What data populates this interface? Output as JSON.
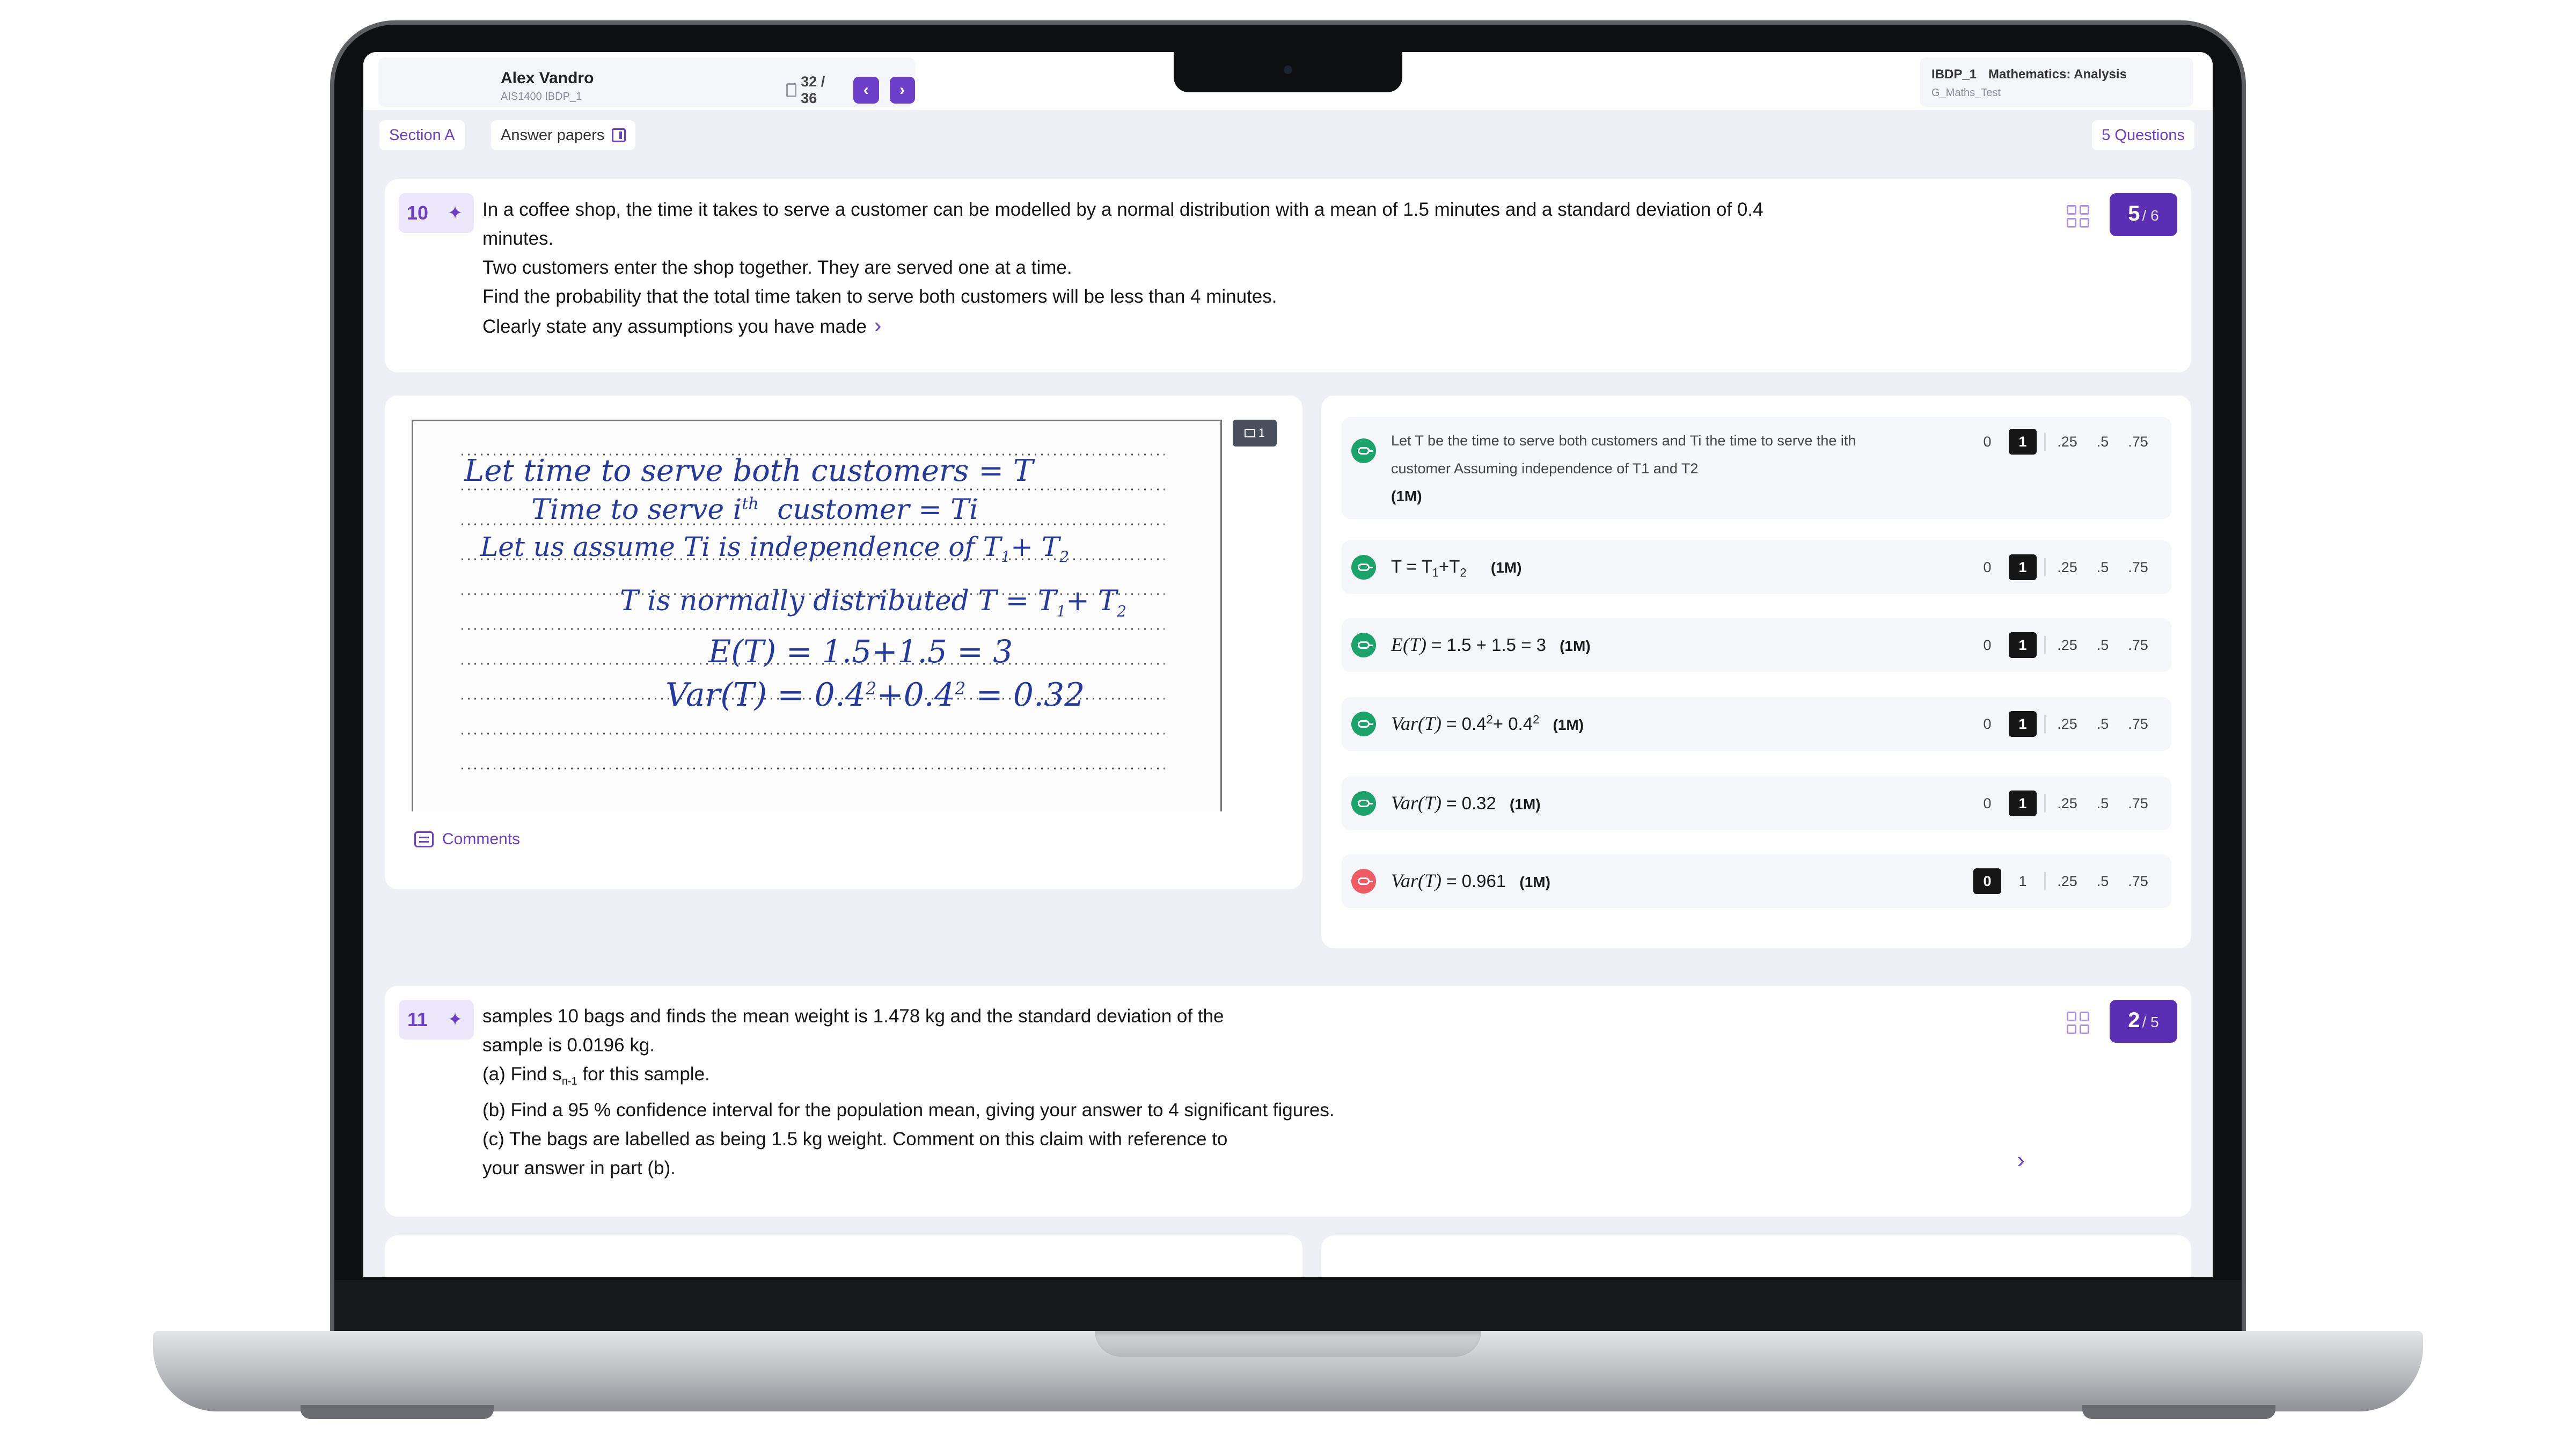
{
  "header": {
    "student_name": "Alex Vandro",
    "student_meta": "AIS1400 IBDP_1",
    "page_count": "32 / 36",
    "prev_icon": "chevron-left-icon",
    "next_icon": "chevron-right-icon",
    "exam_class": "IBDP_1",
    "exam_subject": "Mathematics: Analysis",
    "exam_test": "G_Maths_Test"
  },
  "section_bar": {
    "section_label": "Section A",
    "answers_label": "Answer papers",
    "questions_label": "5 Questions"
  },
  "question10": {
    "number": "10",
    "lines": [
      "In a coffee shop, the time it takes to serve a customer can be modelled by a normal distribution  with a mean of 1.5 minutes and a standard deviation of 0.4",
      "minutes.",
      "Two customers enter the shop together. They are served one at a time.",
      "Find the probability that the total time taken to serve both customers will be less than 4 minutes.",
      "Clearly state any assumptions you have made"
    ],
    "score": "5",
    "total": "/ 6"
  },
  "answer_scan": {
    "page_tag": "1",
    "handwriting": [
      "Let   time to serve both customers   =  T",
      "Time to serve i",
      "th",
      "customer   =  Ti",
      "Let us assume   Ti   is  independence of  T",
      "1",
      "+ T",
      "2",
      "T is normally distributed   T = T",
      "E(T)  = 1.5+1.5 = 3",
      "Var(T)  = 0.4",
      "2",
      "+0.4",
      "= 0.32"
    ],
    "comments_label": "Comments"
  },
  "markscheme": {
    "score_options": [
      "0",
      "1",
      ".25",
      ".5",
      ".75"
    ],
    "rows": [
      {
        "text": "Let T be the time to serve both customers and Ti the time to serve the ith customer Assuming independence of T1 and T2",
        "mark": "(1M)",
        "status": "correct",
        "selected": "1"
      },
      {
        "text": "T = T",
        "sub1": "1",
        "plus": "+T",
        "sub2": "2",
        "mark": "(1M)",
        "status": "correct",
        "selected": "1"
      },
      {
        "expr": "E(T)",
        "text": "= 1.5 + 1.5 = 3",
        "mark": "(1M)",
        "status": "correct",
        "selected": "1"
      },
      {
        "expr": "Var(T)",
        "text": "= 0.4",
        "sup1": "2",
        "plus": "+ 0.4",
        "sup2": "2",
        "mark": "(1M)",
        "status": "correct",
        "selected": "1"
      },
      {
        "expr": "Var(T)",
        "text": "= 0.32",
        "mark": "(1M)",
        "status": "correct",
        "selected": "1"
      },
      {
        "expr": "Var(T)",
        "text": "= 0.961",
        "mark": "(1M)",
        "status": "incorrect",
        "selected": "0"
      }
    ]
  },
  "question11": {
    "number": "11",
    "lines": [
      "samples 10 bags and finds the mean weight is 1.478 kg and the standard deviation of the",
      "sample is 0.0196 kg.",
      "(a) Find  s",
      "n-1",
      "  for this sample.",
      "(b) Find a 95 % confidence interval for the population mean, giving your answer to 4 significant figures.",
      "(c) The bags are labelled as being 1.5 kg weight. Comment on this claim with reference to",
      "your answer in part (b)."
    ],
    "score": "2",
    "total": "/ 5"
  },
  "colors": {
    "accent": "#6d3fc9",
    "badge": "#5b2fb3",
    "correct": "#1aa36a",
    "incorrect": "#ef5a63",
    "ink": "#253a9e"
  }
}
